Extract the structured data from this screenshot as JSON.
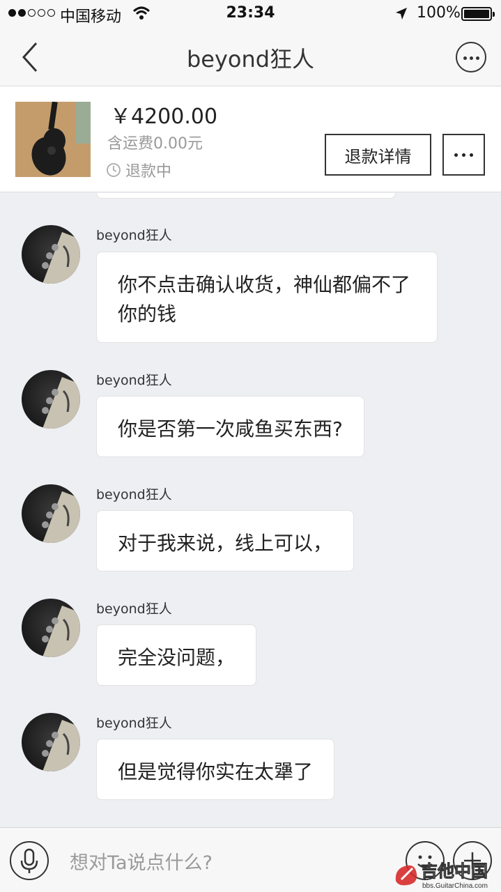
{
  "status_bar": {
    "carrier": "中国移动",
    "time": "23:34",
    "battery": "100%"
  },
  "nav": {
    "title": "beyond狂人"
  },
  "product": {
    "price": "￥4200.00",
    "shipping": "含运费0.00元",
    "status": "退款中",
    "refund_button": "退款详情"
  },
  "messages": [
    {
      "sender": "beyond狂人",
      "text": "你不点击确认收货，神仙都偏不了你的钱"
    },
    {
      "sender": "beyond狂人",
      "text": "你是否第一次咸鱼买东西?"
    },
    {
      "sender": "beyond狂人",
      "text": "对于我来说，线上可以，"
    },
    {
      "sender": "beyond狂人",
      "text": "完全没问题，"
    },
    {
      "sender": "beyond狂人",
      "text": "但是觉得你实在太犟了"
    }
  ],
  "input": {
    "placeholder": "想对Ta说点什么?"
  },
  "watermark": {
    "title": "吉他中国",
    "url": "bbs.GuitarChina.com"
  }
}
